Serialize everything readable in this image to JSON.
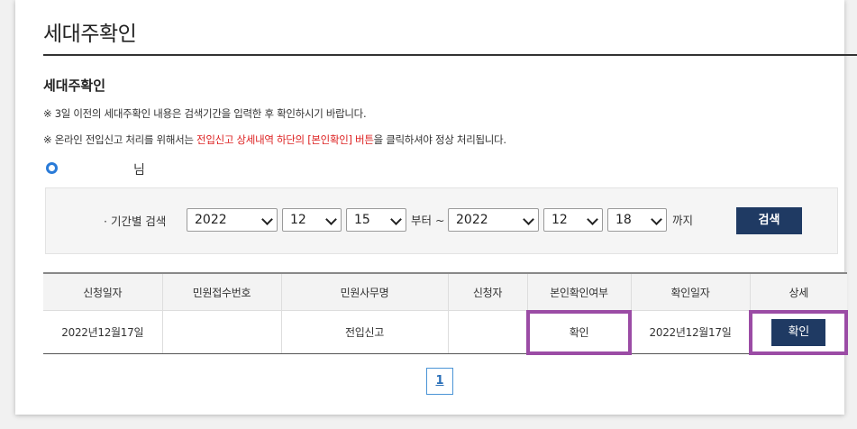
{
  "page_title": "세대주확인",
  "section_title": "세대주확인",
  "notices": {
    "line1": "※ 3일 이전의 세대주확인 내용은 검색기간을 입력한 후 확인하시기 바랍니다.",
    "line2_prefix": "※ 온라인 전입신고 처리를 위해서는 ",
    "line2_red": "전입신고 상세내역 하단의 [본인확인] 버튼",
    "line2_suffix": "을 클릭하셔야 정상 처리됩니다."
  },
  "user": {
    "suffix": "님"
  },
  "search": {
    "label": "· 기간별 검색",
    "from_year": "2022",
    "from_month": "12",
    "from_day": "15",
    "from_text": "부터 ~",
    "to_year": "2022",
    "to_month": "12",
    "to_day": "18",
    "to_text": "까지",
    "button": "검색"
  },
  "table": {
    "headers": [
      "신청일자",
      "민원접수번호",
      "민원사무명",
      "신청자",
      "본인확인여부",
      "확인일자",
      "상세"
    ],
    "rows": [
      [
        "2022년12월17일",
        "",
        "전입신고",
        "",
        "확인",
        "2022년12월17일",
        "확인"
      ]
    ]
  },
  "pagination": {
    "current": "1"
  },
  "colors": {
    "primary_button": "#1f3a63",
    "highlight": "#9b4ca5",
    "notice_red": "#d22222",
    "radio": "#2a7bd8"
  }
}
